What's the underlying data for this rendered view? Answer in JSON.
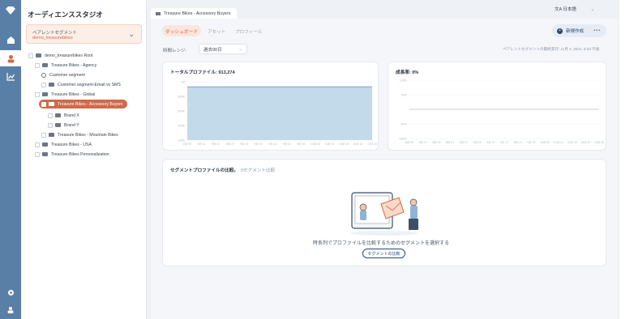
{
  "app": {
    "title": "オーディエンススタジオ"
  },
  "segment_selector": {
    "label": "ペアレントセグメント",
    "value": "demo_treasurebikes"
  },
  "tree": [
    {
      "label": "demo_treasurebikes Root",
      "level": 0,
      "type": "folder"
    },
    {
      "label": "Treasure Bikes - Agency",
      "level": 1,
      "type": "folder"
    },
    {
      "label": "Customer segment",
      "level": 2,
      "type": "segment"
    },
    {
      "label": "Customer segment-Email vs SMS",
      "level": 2,
      "type": "folder"
    },
    {
      "label": "Treasure Bikes - Global",
      "level": 1,
      "type": "folder"
    },
    {
      "label": "Treasure Bikes - Accessory Buyers",
      "level": 2,
      "type": "folder",
      "selected": true
    },
    {
      "label": "Brand X",
      "level": 3,
      "type": "folder"
    },
    {
      "label": "Brand Y",
      "level": 3,
      "type": "folder"
    },
    {
      "label": "Treasure Bikes - Mountain Bikes",
      "level": 2,
      "type": "folder"
    },
    {
      "label": "Treasure Bikes - USA",
      "level": 1,
      "type": "folder"
    },
    {
      "label": "Treasure Bikes Personalization",
      "level": 1,
      "type": "folder"
    }
  ],
  "tab": {
    "label": "Treasure Bikes - Accessory Buyers"
  },
  "language": {
    "label": "日本語"
  },
  "subtabs": {
    "active": "ダッシュボード",
    "assets": "アセット",
    "profile": "プロフィール"
  },
  "actions": {
    "new_label": "新規作成",
    "more": "•••"
  },
  "range": {
    "label": "時間レンジ:",
    "value": "過去90日"
  },
  "last_update": "ペアレントセグメントの最終実行: 11月 4, 2021, 5:33 午後",
  "total_card": {
    "title": "トータルプロファイル: 913,274",
    "chart_data": {
      "type": "area",
      "title": "トータルプロファイル: 913,274",
      "categories": [
        "8月 06",
        "8月 11",
        "8月 21",
        "8月 27",
        "9月 03",
        "9月 10",
        "9月 16",
        "9月 22",
        "9月 28",
        "10月 05",
        "10月 11",
        "10月 16",
        "10月 22",
        "10月 28"
      ],
      "yticks": [
        "1M",
        "800K",
        "600K",
        "400K",
        "200K"
      ],
      "values": [
        913274,
        913274,
        913274,
        913274,
        913274,
        913274,
        913274,
        913274,
        913274,
        913274,
        913274,
        913274,
        913274,
        913274
      ],
      "ylim": [
        0,
        1000000
      ],
      "color": "#b9d3e8"
    }
  },
  "growth_card": {
    "title": "成長率: 0%",
    "chart_data": {
      "type": "line",
      "title": "成長率: 0%",
      "categories": [
        "8月 06",
        "8月 12",
        "8月 16",
        "8月 21",
        "8月 27",
        "9月 03",
        "9月 10",
        "9月 17",
        "9月 24",
        "9月 30",
        "10月 06",
        "10月 12",
        "10月 18",
        "10月 22",
        "10月 28"
      ],
      "yticks": [
        "100%",
        "50%",
        "",
        "-50%",
        "-100%"
      ],
      "values": [
        0,
        0,
        0,
        0,
        0,
        0,
        0,
        0,
        0,
        0,
        0,
        0,
        0,
        0,
        0
      ],
      "ylim": [
        -100,
        100
      ],
      "color": "#9aa4b0"
    }
  },
  "compare": {
    "title": "セグメントプロファイルの比較。",
    "subtitle": "0セグメント比較",
    "empty_text": "時系列でプロファイルを比較するためのセグメントを選択する",
    "button_label": "セグメントの比較"
  }
}
